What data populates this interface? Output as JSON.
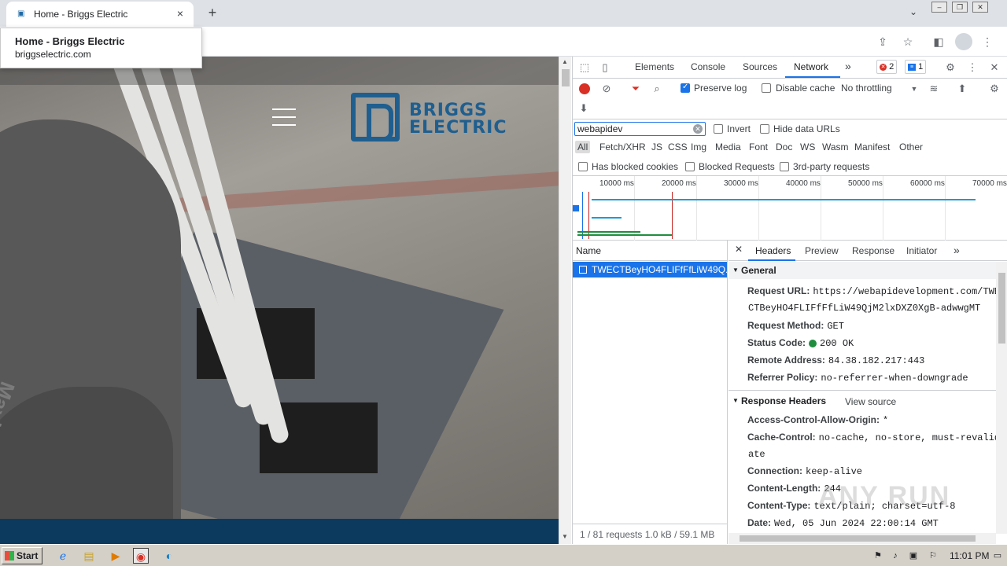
{
  "browser": {
    "tab_title": "Home - Briggs Electric",
    "new_tab": "+",
    "close_tab": "×",
    "hover_title": "Home - Briggs Electric",
    "hover_url": "briggselectric.com"
  },
  "page": {
    "logo_line1": "BRIGGS",
    "logo_line2": "ELECTRIC",
    "glove_text": "MaxiFlex"
  },
  "devtools": {
    "tabs": [
      "Elements",
      "Console",
      "Sources",
      "Network"
    ],
    "more": "»",
    "error_count": "2",
    "message_count": "1",
    "preserve_log": "Preserve log",
    "disable_cache": "Disable cache",
    "throttling": "No throttling",
    "filter_value": "webapidev",
    "invert": "Invert",
    "hide_data_urls": "Hide data URLs",
    "types": [
      "All",
      "Fetch/XHR",
      "JS",
      "CSS",
      "Img",
      "Media",
      "Font",
      "Doc",
      "WS",
      "Wasm",
      "Manifest",
      "Other"
    ],
    "has_blocked_cookies": "Has blocked cookies",
    "blocked_requests": "Blocked Requests",
    "third_party": "3rd-party requests",
    "ticks": [
      "10000 ms",
      "20000 ms",
      "30000 ms",
      "40000 ms",
      "50000 ms",
      "60000 ms",
      "70000 ms"
    ],
    "name_header": "Name",
    "request_name": "TWECTBeyHO4FLIFfFfLiW49Q...",
    "status_bar": "1 / 81 requests   1.0 kB / 59.1 MB",
    "detail_tabs": [
      "Headers",
      "Preview",
      "Response",
      "Initiator"
    ],
    "general": {
      "title": "General",
      "request_url_key": "Request URL:",
      "request_url_val": "https://webapidevelopment.com/TWE",
      "request_url_cont": "CTBeyHO4FLIFfFfLiW49QjM2lxDXZ0XgB-adwwgMT",
      "method_key": "Request Method:",
      "method_val": "GET",
      "status_key": "Status Code:",
      "status_val": "200 OK",
      "remote_key": "Remote Address:",
      "remote_val": "84.38.182.217:443",
      "referrer_key": "Referrer Policy:",
      "referrer_val": "no-referrer-when-downgrade"
    },
    "response_headers": {
      "title": "Response Headers",
      "view_source": "View source",
      "acao_key": "Access-Control-Allow-Origin:",
      "acao_val": "*",
      "cache_key": "Cache-Control:",
      "cache_val": "no-cache, no-store, must-revalid",
      "cache_cont": "ate",
      "conn_key": "Connection:",
      "conn_val": "keep-alive",
      "len_key": "Content-Length:",
      "len_val": "244",
      "type_key": "Content-Type:",
      "type_val": "text/plain; charset=utf-8",
      "date_key": "Date:",
      "date_val": "Wed, 05 Jun 2024 22:00:14 GMT"
    },
    "watermark": "ANY RUN"
  },
  "taskbar": {
    "start": "Start",
    "clock": "11:01 PM"
  }
}
